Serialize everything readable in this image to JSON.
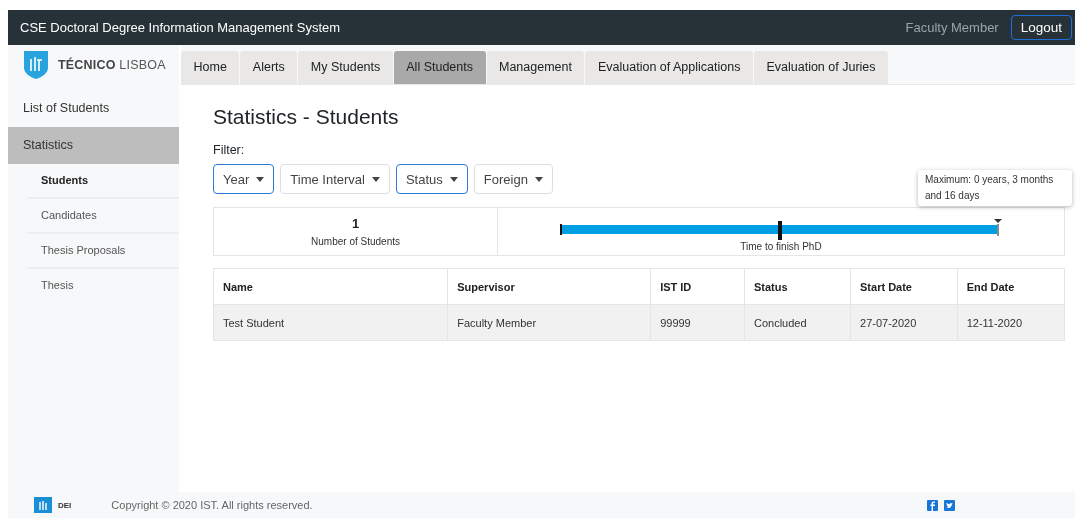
{
  "header": {
    "title": "CSE Doctoral Degree Information Management System",
    "user": "Faculty Member",
    "logout": "Logout"
  },
  "logo": {
    "bold": "TÉCNICO",
    "light": "LISBOA"
  },
  "tabs": [
    {
      "label": "Home",
      "selected": false
    },
    {
      "label": "Alerts",
      "selected": false
    },
    {
      "label": "My Students",
      "selected": false
    },
    {
      "label": "All Students",
      "selected": true
    },
    {
      "label": "Management",
      "selected": false
    },
    {
      "label": "Evaluation of Applications",
      "selected": false
    },
    {
      "label": "Evaluation of Juries",
      "selected": false
    }
  ],
  "sidebar": {
    "items": [
      {
        "label": "List of Students",
        "selected": false
      },
      {
        "label": "Statistics",
        "selected": true,
        "children": [
          {
            "label": "Students",
            "selected": true
          },
          {
            "label": "Candidates",
            "selected": false
          },
          {
            "label": "Thesis Proposals",
            "selected": false
          },
          {
            "label": "Thesis",
            "selected": false
          }
        ]
      }
    ]
  },
  "page": {
    "title": "Statistics - Students",
    "filter_label": "Filter:",
    "filters": [
      {
        "label": "Year",
        "active": true
      },
      {
        "label": "Time Interval",
        "active": false
      },
      {
        "label": "Status",
        "active": true
      },
      {
        "label": "Foreign",
        "active": false
      }
    ]
  },
  "summary": {
    "count": "1",
    "count_label": "Number of Students",
    "chart_label": "Time to finish PhD",
    "tooltip": "Maximum: 0 years, 3 months and 16 days"
  },
  "table": {
    "columns": [
      "Name",
      "Supervisor",
      "IST ID",
      "Status",
      "Start Date",
      "End Date"
    ],
    "rows": [
      [
        "Test Student",
        "Faculty Member",
        "99999",
        "Concluded",
        "27-07-2020",
        "12-11-2020"
      ]
    ]
  },
  "footer": {
    "logo_text": "DEI",
    "copyright": "Copyright © 2020 IST. All rights reserved."
  }
}
